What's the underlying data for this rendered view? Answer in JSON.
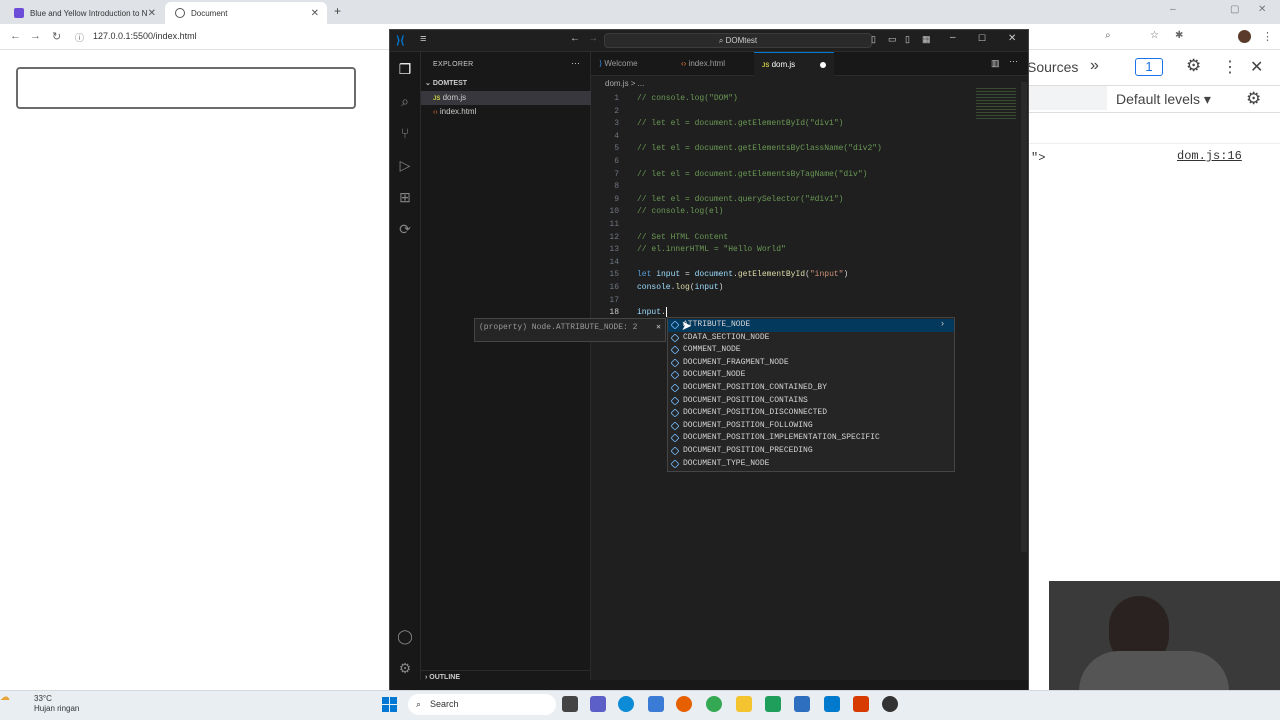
{
  "browser": {
    "tabs": [
      {
        "title": "Blue and Yellow Introduction to N",
        "active": false
      },
      {
        "title": "Document",
        "active": true
      }
    ],
    "new_tab_icon": "plus-icon",
    "url": "127.0.0.1:5500/index.html"
  },
  "devtools": {
    "tab_sources": "Sources",
    "issues_count": "1",
    "levels_label": "Default levels",
    "log_fragment": "\">",
    "log_source": "dom.js:16"
  },
  "vscode": {
    "search_label": "DOMtest",
    "explorer_label": "EXPLORER",
    "folder_label": "DOMTEST",
    "files": [
      {
        "name": "dom.js",
        "type": "JS",
        "selected": true
      },
      {
        "name": "index.html",
        "type": "<>",
        "selected": false
      }
    ],
    "outline_label": "OUTLINE",
    "editor_tabs": [
      {
        "label": "Welcome",
        "active": false
      },
      {
        "label": "index.html",
        "active": false
      },
      {
        "label": "dom.js",
        "active": true
      }
    ],
    "breadcrumb": "dom.js > ...",
    "lines": [
      {
        "n": "1",
        "parts": [
          [
            "c-com",
            "// console.log(\"DOM\")"
          ]
        ]
      },
      {
        "n": "2",
        "parts": []
      },
      {
        "n": "3",
        "parts": [
          [
            "c-com",
            "// let el = document.getElementById(\"div1\")"
          ]
        ]
      },
      {
        "n": "4",
        "parts": []
      },
      {
        "n": "5",
        "parts": [
          [
            "c-com",
            "// let el = document.getElementsByClassName(\"div2\")"
          ]
        ]
      },
      {
        "n": "6",
        "parts": []
      },
      {
        "n": "7",
        "parts": [
          [
            "c-com",
            "// let el = document.getElementsByTagName(\"div\")"
          ]
        ]
      },
      {
        "n": "8",
        "parts": []
      },
      {
        "n": "9",
        "parts": [
          [
            "c-com",
            "// let el = document.querySelector(\"#div1\")"
          ]
        ]
      },
      {
        "n": "10",
        "parts": [
          [
            "c-com",
            "// console.log(el)"
          ]
        ]
      },
      {
        "n": "11",
        "parts": []
      },
      {
        "n": "12",
        "parts": [
          [
            "c-com",
            "// Set HTML Content"
          ]
        ]
      },
      {
        "n": "13",
        "parts": [
          [
            "c-com",
            "// el.innerHTML = \"Hello World\""
          ]
        ]
      },
      {
        "n": "14",
        "parts": []
      },
      {
        "n": "15",
        "parts": [
          [
            "c-kw",
            "let "
          ],
          [
            "c-var",
            "input"
          ],
          [
            "c-def",
            " = "
          ],
          [
            "c-var",
            "document"
          ],
          [
            "c-def",
            "."
          ],
          [
            "c-fn",
            "getElementById"
          ],
          [
            "c-def",
            "("
          ],
          [
            "c-str",
            "\"input\""
          ],
          [
            "c-def",
            ")"
          ]
        ]
      },
      {
        "n": "16",
        "parts": [
          [
            "c-var",
            "console"
          ],
          [
            "c-def",
            "."
          ],
          [
            "c-fn",
            "log"
          ],
          [
            "c-def",
            "("
          ],
          [
            "c-var",
            "input"
          ],
          [
            "c-def",
            ")"
          ]
        ]
      },
      {
        "n": "17",
        "parts": []
      },
      {
        "n": "18",
        "parts": [
          [
            "c-var",
            "input"
          ],
          [
            "c-def",
            "."
          ]
        ]
      }
    ],
    "hover_text": "(property) Node.ATTRIBUTE_NODE: 2",
    "suggestions": [
      "ATTRIBUTE_NODE",
      "CDATA_SECTION_NODE",
      "COMMENT_NODE",
      "DOCUMENT_FRAGMENT_NODE",
      "DOCUMENT_NODE",
      "DOCUMENT_POSITION_CONTAINED_BY",
      "DOCUMENT_POSITION_CONTAINS",
      "DOCUMENT_POSITION_DISCONNECTED",
      "DOCUMENT_POSITION_FOLLOWING",
      "DOCUMENT_POSITION_IMPLEMENTATION_SPECIFIC",
      "DOCUMENT_POSITION_PRECEDING",
      "DOCUMENT_TYPE_NODE"
    ]
  },
  "taskbar": {
    "temp": "33°C",
    "weather": "Hujan ringan",
    "search_label": "Search"
  }
}
